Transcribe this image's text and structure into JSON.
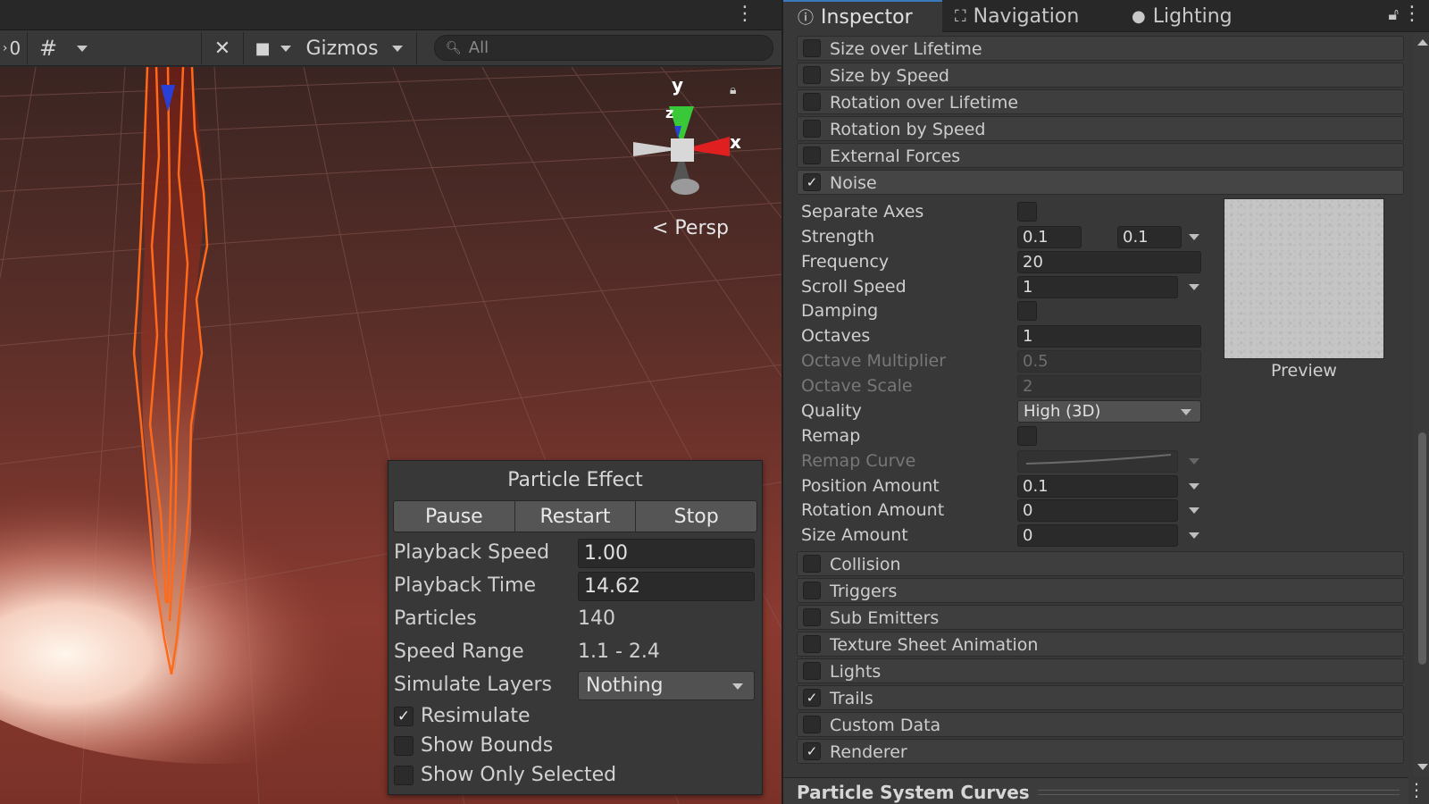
{
  "scene": {
    "toolbar": {
      "layer_count": "0",
      "gizmos_label": "Gizmos",
      "search_placeholder": "All"
    },
    "gizmo": {
      "y_label": "y",
      "z_label": "z",
      "x_label": "x",
      "persp_label": "< Persp"
    },
    "particle_effect": {
      "title": "Particle Effect",
      "buttons": {
        "pause": "Pause",
        "restart": "Restart",
        "stop": "Stop"
      },
      "playback_speed": {
        "label": "Playback Speed",
        "value": "1.00"
      },
      "playback_time": {
        "label": "Playback Time",
        "value": "14.62"
      },
      "particles": {
        "label": "Particles",
        "value": "140"
      },
      "speed_range": {
        "label": "Speed Range",
        "value": "1.1 - 2.4"
      },
      "simulate_layers": {
        "label": "Simulate Layers",
        "value": "Nothing"
      },
      "resimulate": {
        "label": "Resimulate",
        "checked": true
      },
      "show_bounds": {
        "label": "Show Bounds",
        "checked": false
      },
      "show_only_selected": {
        "label": "Show Only Selected",
        "checked": false
      }
    }
  },
  "inspector": {
    "tabs": {
      "inspector": "Inspector",
      "navigation": "Navigation",
      "lighting": "Lighting"
    },
    "modules_top": [
      {
        "label": "Size over Lifetime",
        "checked": false
      },
      {
        "label": "Size by Speed",
        "checked": false
      },
      {
        "label": "Rotation over Lifetime",
        "checked": false
      },
      {
        "label": "Rotation by Speed",
        "checked": false
      },
      {
        "label": "External Forces",
        "checked": false
      },
      {
        "label": "Noise",
        "checked": true
      }
    ],
    "noise": {
      "separate_axes": {
        "label": "Separate Axes"
      },
      "strength": {
        "label": "Strength",
        "min": "0.1",
        "max": "0.1"
      },
      "frequency": {
        "label": "Frequency",
        "value": "20"
      },
      "scroll_speed": {
        "label": "Scroll Speed",
        "value": "1"
      },
      "damping": {
        "label": "Damping"
      },
      "octaves": {
        "label": "Octaves",
        "value": "1"
      },
      "octave_multiplier": {
        "label": "Octave Multiplier",
        "value": "0.5"
      },
      "octave_scale": {
        "label": "Octave Scale",
        "value": "2"
      },
      "quality": {
        "label": "Quality",
        "value": "High (3D)"
      },
      "remap": {
        "label": "Remap"
      },
      "remap_curve": {
        "label": "Remap Curve"
      },
      "position_amount": {
        "label": "Position Amount",
        "value": "0.1"
      },
      "rotation_amount": {
        "label": "Rotation Amount",
        "value": "0"
      },
      "size_amount": {
        "label": "Size Amount",
        "value": "0"
      },
      "preview_label": "Preview"
    },
    "modules_bottom": [
      {
        "label": "Collision",
        "checked": false
      },
      {
        "label": "Triggers",
        "checked": false
      },
      {
        "label": "Sub Emitters",
        "checked": false
      },
      {
        "label": "Texture Sheet Animation",
        "checked": false
      },
      {
        "label": "Lights",
        "checked": false
      },
      {
        "label": "Trails",
        "checked": true
      },
      {
        "label": "Custom Data",
        "checked": false
      },
      {
        "label": "Renderer",
        "checked": true
      }
    ],
    "curves_header": "Particle System Curves"
  },
  "colors": {
    "accent": "#3a79bb",
    "flame": "#ff6a1a",
    "gizmo_x": "#e02020",
    "gizmo_y": "#38c838",
    "gizmo_z": "#2840d8"
  }
}
